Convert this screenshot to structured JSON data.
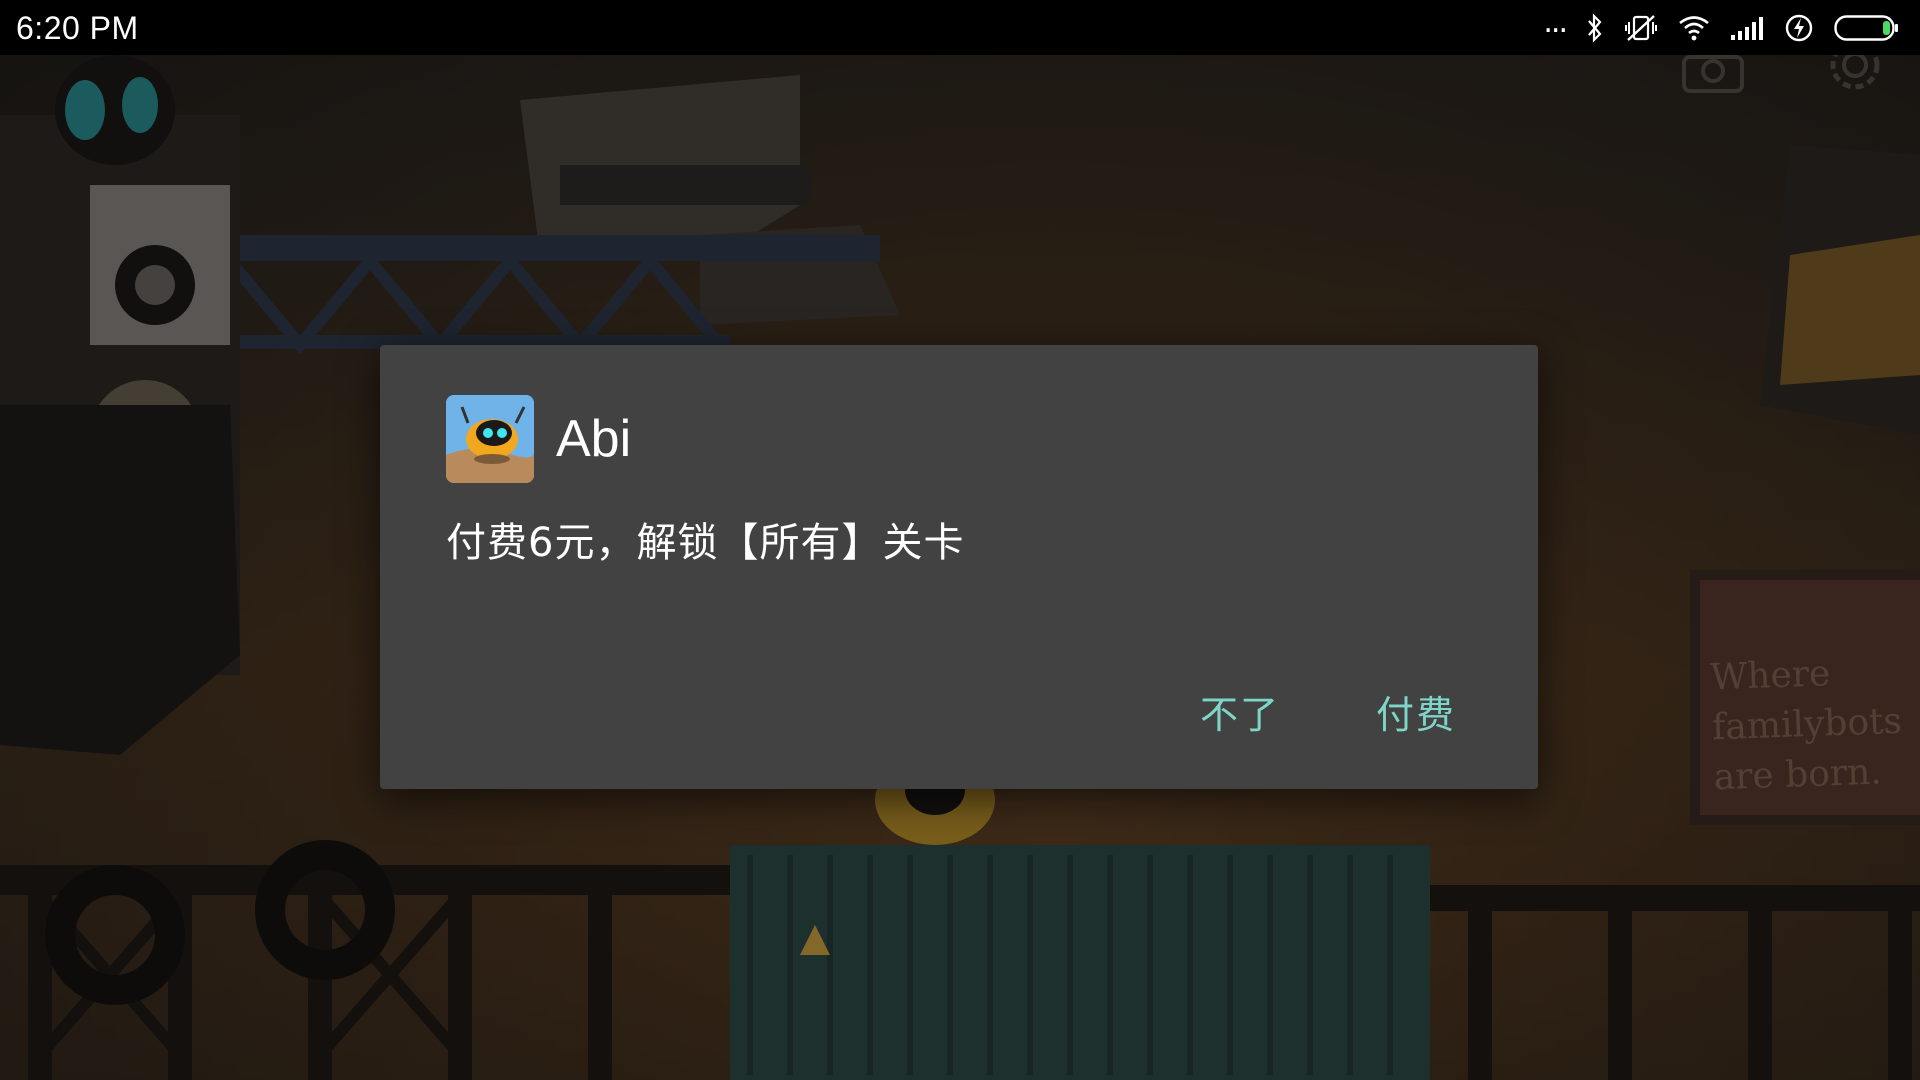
{
  "status_bar": {
    "time": "6:20 PM",
    "more_indicator": "...",
    "icons": [
      "bluetooth-icon",
      "vibrate-off-icon",
      "wifi-icon",
      "signal-icon",
      "charging-icon",
      "battery-icon"
    ]
  },
  "background": {
    "sign_text": "Where familybots are born."
  },
  "dialog": {
    "app_icon": "abi-app-icon",
    "title": "Abi",
    "message": "付费6元，解锁【所有】关卡",
    "cancel_label": "不了",
    "confirm_label": "付费",
    "button_color": "#7fd6c8",
    "background_color": "#424242"
  }
}
